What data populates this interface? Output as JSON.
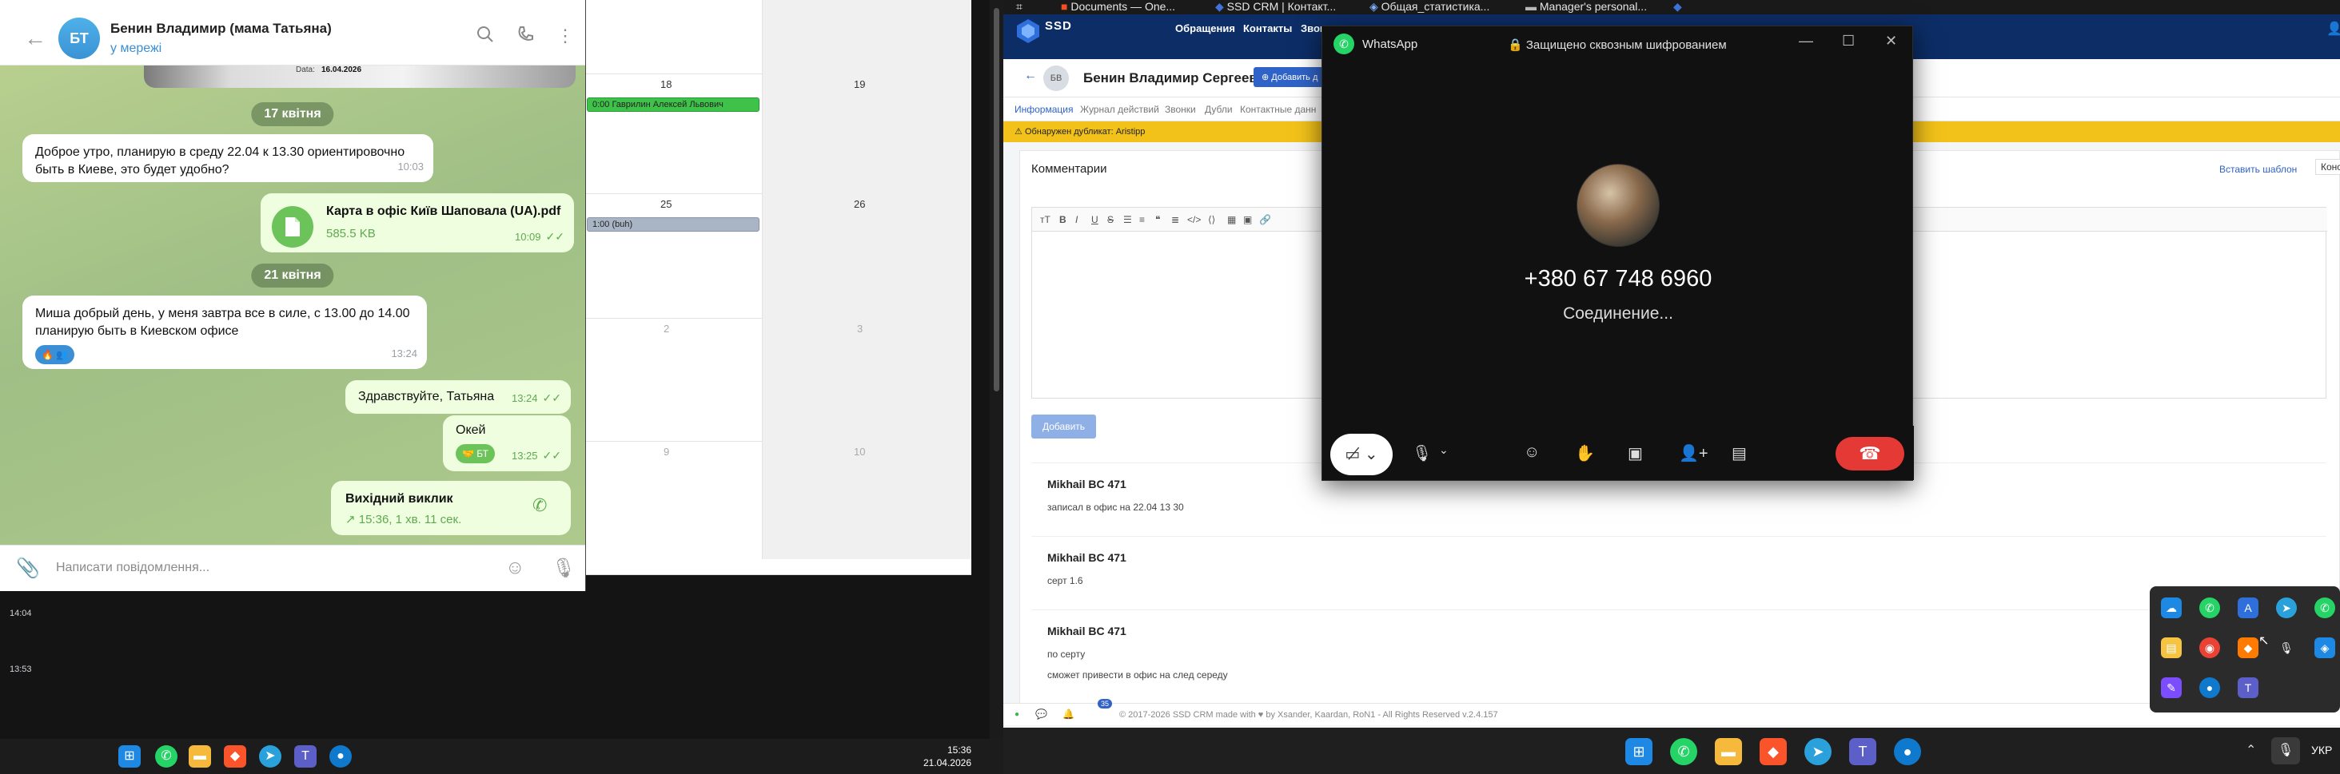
{
  "telegram": {
    "avatar_initials": "БТ",
    "contact_name": "Бенин Владимир (мама Татьяна)",
    "status": "у мережі",
    "preview_caption": "Data:",
    "preview_date": "16.04.2026",
    "date1": "17 квітня",
    "msg1_text": "Доброе утро, планирую в среду 22.04 к 13.30 ориентировочно быть в Киеве, это будет удобно?",
    "msg1_time": "10:03",
    "file_name": "Карта в офіс Київ Шаповала (UA).pdf",
    "file_size": "585.5 KB",
    "file_time": "10:09",
    "date2": "21 квітня",
    "msg2_text": "Миша добрый день, у меня завтра все в силе, с 13.00 до 14.00 планирую быть в Киевском офисе",
    "msg2_time": "13:24",
    "msg3_text": "Здравствуйте, Татьяна",
    "msg3_time": "13:24",
    "msg4_text": "Окей",
    "msg4_time": "13:25",
    "call_title": "Вихідний виклик",
    "call_detail": "15:36, 1 хв. 11 сек.",
    "input_placeholder": "Написати повідомлення..."
  },
  "calendar": {
    "days": [
      "18",
      "19",
      "25",
      "26",
      "2",
      "3",
      "9",
      "10"
    ],
    "event1": "0:00 Гаврилин Алексей Львович",
    "event2": "1:00 (buh)"
  },
  "left_panel": {
    "time1": "14:04",
    "time2": "13:53"
  },
  "left_taskbar": {
    "clock_time": "15:36",
    "clock_date": "21.04.2026"
  },
  "browser": {
    "tabs": [
      "Documents — One...",
      "SSD CRM | Контакт...",
      "Общая_статистика...",
      "Manager's personal..."
    ]
  },
  "crm": {
    "logo_text": "SSD",
    "nav": [
      "Обращения",
      "Контакты",
      "Звон"
    ],
    "avatar_initials": "БВ",
    "contact_title": "Бенин Владимир Сергеевич",
    "add_button": "Добавить д",
    "tabs": [
      "Информация",
      "Журнал действий",
      "Звонки",
      "Дубли",
      "Контактные данн"
    ],
    "warning": "Обнаружен дубликат: Aristipp",
    "comments_heading": "Комментарии",
    "insert_template": "Вставить шаблон",
    "consult": "Консульт",
    "add_comment_button": "Добавить",
    "comments": [
      {
        "author": "Mikhail BC 471",
        "text": "записал в офис на 22.04 13 30"
      },
      {
        "author": "Mikhail BC 471",
        "text": "серт 1.6"
      },
      {
        "author": "Mikhail BC 471",
        "text": "по серту"
      },
      {
        "author": "",
        "text": "сможет привести в офис на след середу"
      }
    ],
    "notif_count": "35",
    "footer": "© 2017-2026 SSD CRM made with ♥ by Xsander, Kaardan, RoN1 - All Rights Reserved v.2.4.157"
  },
  "whatsapp": {
    "app_name": "WhatsApp",
    "e2e": "Защищено сквозным шифрованием",
    "phone": "+380 67 748 6960",
    "status": "Соединение..."
  },
  "right_taskbar": {
    "lang": "УКР"
  }
}
